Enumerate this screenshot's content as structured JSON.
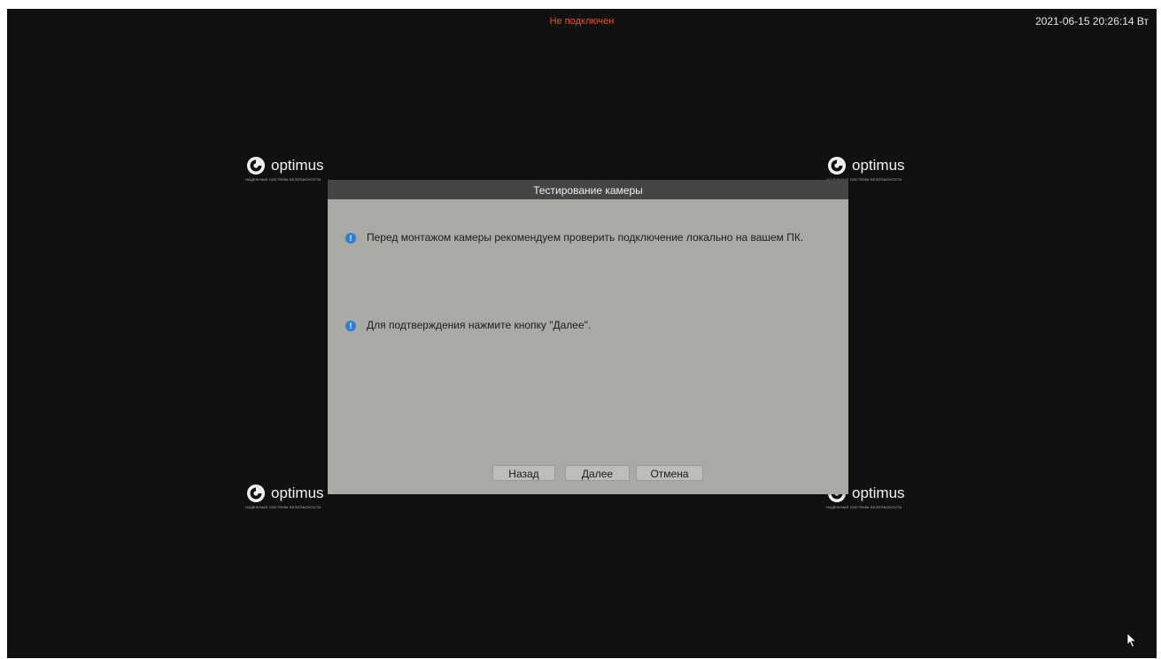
{
  "status_bar": {
    "connection_status": "Не подключен",
    "datetime": "2021-06-15 20:26:14 Вт",
    "status_color": "#e0562a"
  },
  "logo": {
    "brand": "optimus",
    "tagline": "НАДЕЖНЫЕ СИСТЕМЫ БЕЗОПАСНОСТИ",
    "icon": "optimus-logo-icon"
  },
  "dialog": {
    "title": "Тестирование камеры",
    "messages": [
      {
        "icon": "info-icon",
        "text": "Перед монтажом камеры рекомендуем проверить подключение локально на вашем ПК."
      },
      {
        "icon": "info-icon",
        "text": "Для подтверждения нажмите кнопку \"Далее\"."
      }
    ],
    "buttons": {
      "back": "Назад",
      "next": "Далее",
      "cancel": "Отмена"
    },
    "accent_color": "#2d7fd6"
  },
  "pointer": {
    "icon": "mouse-cursor-icon"
  }
}
